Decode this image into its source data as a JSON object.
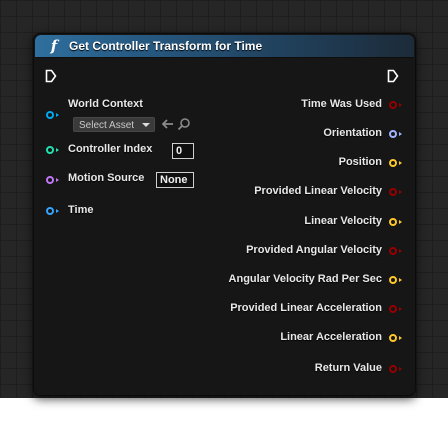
{
  "node": {
    "title": "Get Controller Transform for Time",
    "icon": "function-icon"
  },
  "inputs": {
    "world_context": "World Context",
    "select_asset": "Select Asset",
    "controller_index": "Controller Index",
    "controller_index_value": "0",
    "motion_source": "Motion Source",
    "motion_source_value": "None",
    "time": "Time"
  },
  "outputs": [
    "Time Was Used",
    "Orientation",
    "Position",
    "Provided Linear Velocity",
    "Linear Velocity",
    "Provided Angular Velocity",
    "Angular Velocity Rad Per Sec",
    "Provided Linear Acceleration",
    "Linear Acceleration",
    "Return Value"
  ],
  "colors": {
    "object_pin": "#00a8f4",
    "int_pin": "#1fe3af",
    "name_pin": "#c176f7",
    "float_pin": "#35a4ff",
    "bool_pin": "#950000",
    "rotator_pin": "#a0b4ff",
    "vector_pin": "#fdc828",
    "exec_pin": "#ffffff"
  }
}
